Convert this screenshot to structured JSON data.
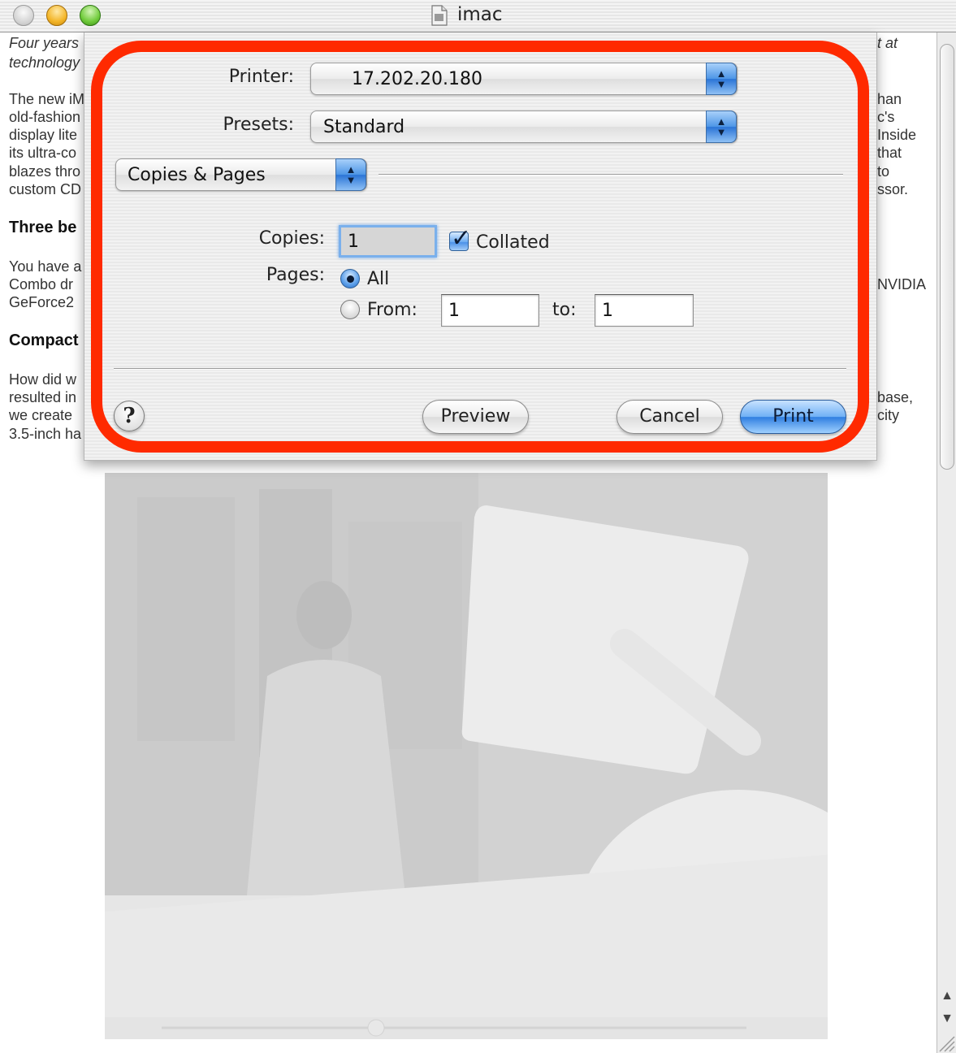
{
  "window": {
    "title": "imac"
  },
  "document": {
    "left_lines": [
      "Four years",
      "technology",
      "The new iM",
      "old-fashion",
      "display lite",
      "its ultra-co",
      "blazes thro",
      "custom CD",
      "Three be",
      "You have a",
      "Combo dr",
      "GeForce2",
      "Compact",
      "How did w",
      "resulted in",
      "we create",
      "3.5-inch ha"
    ],
    "right_lines": [
      "t at",
      "han",
      "c's",
      "Inside",
      "that",
      "to",
      "ssor.",
      "NVIDIA",
      "base,",
      "city"
    ]
  },
  "print_dialog": {
    "printer_label": "Printer:",
    "printer_value": "17.202.20.180",
    "presets_label": "Presets:",
    "presets_value": "Standard",
    "pane_value": "Copies & Pages",
    "copies_label": "Copies:",
    "copies_value": "1",
    "collated_label": "Collated",
    "collated_checked": true,
    "pages_label": "Pages:",
    "all_label": "All",
    "from_label": "From:",
    "from_value": "1",
    "to_label": "to:",
    "to_value": "1",
    "help_label": "?",
    "preview_label": "Preview",
    "cancel_label": "Cancel",
    "print_label": "Print"
  },
  "colors": {
    "highlight": "#ff2a00",
    "accent": "#4a90e8"
  }
}
